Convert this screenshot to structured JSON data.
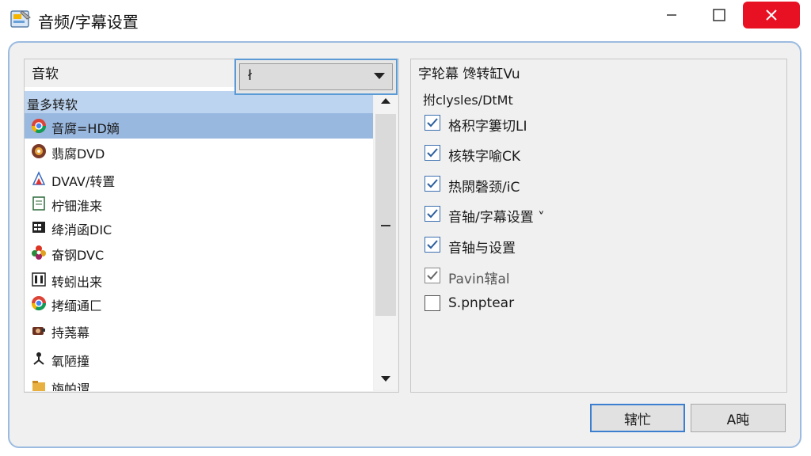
{
  "window": {
    "title": "音频/字幕设置"
  },
  "left": {
    "label": "音软",
    "dropdown_value": "ł",
    "list_header": "量多转软",
    "items": [
      {
        "label": "音腐=HD嫡",
        "icon": "chrome-icon",
        "selected": true
      },
      {
        "label": "翡腐DVD",
        "icon": "disc-icon"
      },
      {
        "label": "DVAV/转置",
        "icon": "dvd-icon"
      },
      {
        "label": "柠钿淮来",
        "icon": "doc-icon"
      },
      {
        "label": "绛消函DIC",
        "icon": "grid-icon"
      },
      {
        "label": "奋钢DVC",
        "icon": "flower-icon"
      },
      {
        "label": "转蚓出来",
        "icon": "film-icon"
      },
      {
        "label": "拷缅通匚",
        "icon": "chrome-icon"
      },
      {
        "label": "持荛幕",
        "icon": "camera-icon"
      },
      {
        "label": "氧陋撞",
        "icon": "person-icon"
      },
      {
        "label": "旃帕谓…",
        "icon": "folder-icon"
      }
    ]
  },
  "right": {
    "title": "字轮幕 馋转缸Vu",
    "subtitle": "拊clysles/DtMt",
    "options": [
      {
        "label": "格积字簍切LI",
        "checked": true,
        "disabled": false
      },
      {
        "label": "核轶字喻CK",
        "checked": true,
        "disabled": false
      },
      {
        "label": "热閖磬颈/iC",
        "checked": true,
        "disabled": false
      },
      {
        "label": "音轴/字幕设置 ˅",
        "checked": true,
        "disabled": false
      },
      {
        "label": "音轴与设置",
        "checked": true,
        "disabled": false
      },
      {
        "label": "Pavin辖al",
        "checked": true,
        "disabled": true
      },
      {
        "label": "S.pnptear",
        "checked": false,
        "disabled": false
      }
    ]
  },
  "buttons": {
    "ok": "辖忙",
    "cancel": "A旽"
  },
  "colors": {
    "accent": "#3c7fd1",
    "selection": "#99b8e0",
    "close": "#e81123"
  }
}
